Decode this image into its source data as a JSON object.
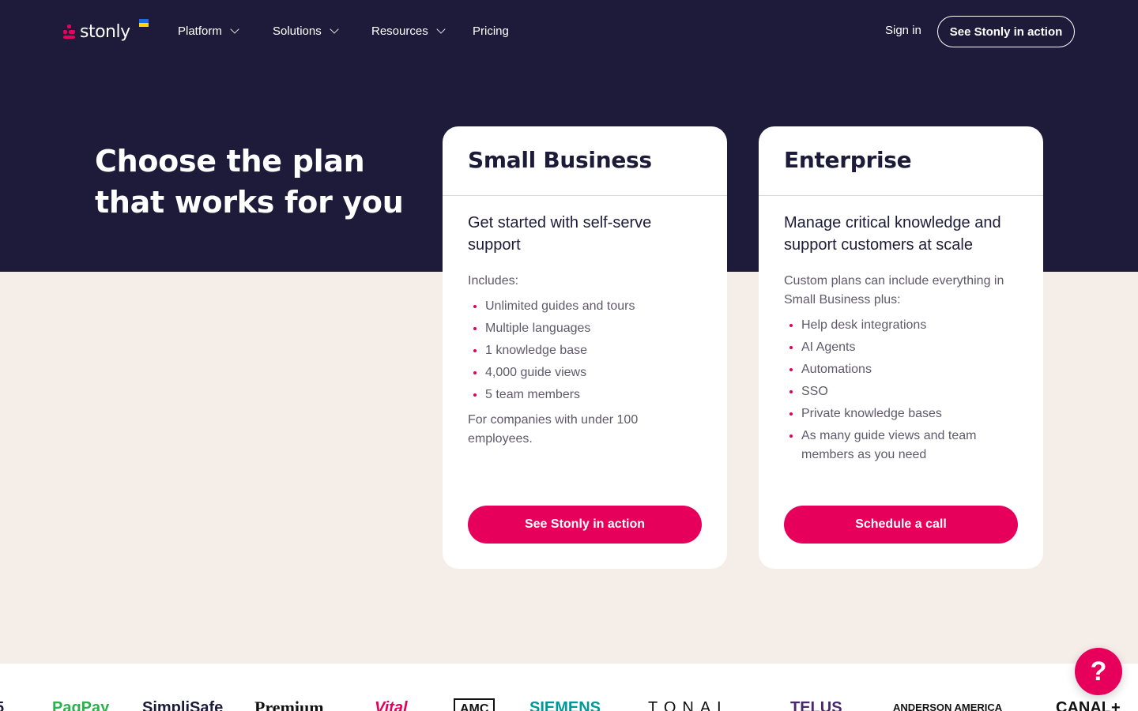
{
  "nav": {
    "logo_text": "stonly",
    "items": [
      {
        "label": "Platform"
      },
      {
        "label": "Solutions"
      },
      {
        "label": "Resources"
      },
      {
        "label": "Pricing"
      }
    ],
    "signin": "Sign in",
    "cta": "See Stonly in action"
  },
  "hero": {
    "title_line1": "Choose the plan",
    "title_line2": "that works for you"
  },
  "plans": [
    {
      "title": "Small Business",
      "subtitle": "Get started with self-serve support",
      "includes_label": "Includes:",
      "features": [
        "Unlimited guides and tours",
        "Multiple languages",
        "1 knowledge base",
        "4,000 guide views",
        "5 team members"
      ],
      "note": "For companies with under 100 employees.",
      "button": "See Stonly in action"
    },
    {
      "title": "Enterprise",
      "subtitle": "Manage critical knowledge and support customers at scale",
      "includes_label": "Custom plans can include everything in Small Business plus:",
      "features": [
        "Help desk integrations",
        "AI Agents",
        "Automations",
        "SSO",
        "Private knowledge bases",
        "As many guide views and team members as you need"
      ],
      "button": "Schedule a call"
    }
  ],
  "customer_logos": [
    "5",
    "PagPay",
    "SimpliSafe",
    "Premium",
    "Vital",
    "AMC",
    "SIEMENS",
    "TONAL",
    "TELUS",
    "ANDERSON AMERICA",
    "CANAL+"
  ],
  "help_button": "?",
  "colors": {
    "navy": "#1e1b3a",
    "accent": "#e6005c",
    "cream": "#f5ede8"
  }
}
